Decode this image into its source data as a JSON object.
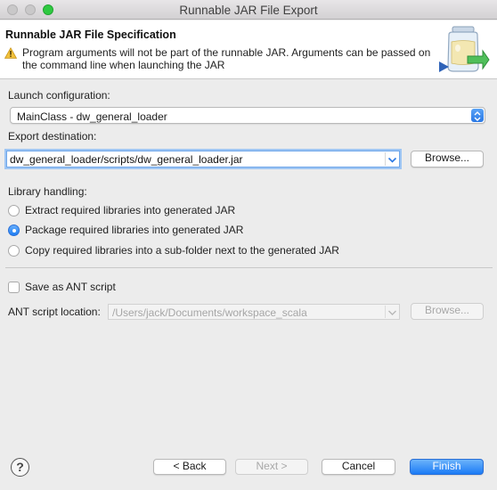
{
  "window": {
    "title": "Runnable JAR File Export"
  },
  "banner": {
    "title": "Runnable JAR File Specification",
    "message_line1": "Program arguments will not be part of the runnable JAR. Arguments can be passed on",
    "message_line2": "the command line when launching the JAR"
  },
  "launch": {
    "label": "Launch configuration:",
    "value": "MainClass - dw_general_loader"
  },
  "export": {
    "label": "Export destination:",
    "value": "dw_general_loader/scripts/dw_general_loader.jar",
    "browse_label": "Browse..."
  },
  "library": {
    "label": "Library handling:",
    "options": [
      {
        "label": "Extract required libraries into generated JAR",
        "selected": false
      },
      {
        "label": "Package required libraries into generated JAR",
        "selected": true
      },
      {
        "label": "Copy required libraries into a sub-folder next to the generated JAR",
        "selected": false
      }
    ]
  },
  "ant": {
    "save_label": "Save as ANT script",
    "save_checked": false,
    "location_label": "ANT script location:",
    "location_value": "/Users/jack/Documents/workspace_scala",
    "browse_label": "Browse..."
  },
  "footer": {
    "help_glyph": "?",
    "back_label": "< Back",
    "next_label": "Next >",
    "cancel_label": "Cancel",
    "finish_label": "Finish"
  },
  "colors": {
    "accent": "#1b7bf6",
    "window_bg": "#ececec",
    "banner_bg": "#ffffff",
    "zoom_button": "#2ec940"
  },
  "icons": [
    "warning-icon",
    "jar-export-icon",
    "help-icon",
    "chevron-down-icon",
    "stepper-icon"
  ]
}
